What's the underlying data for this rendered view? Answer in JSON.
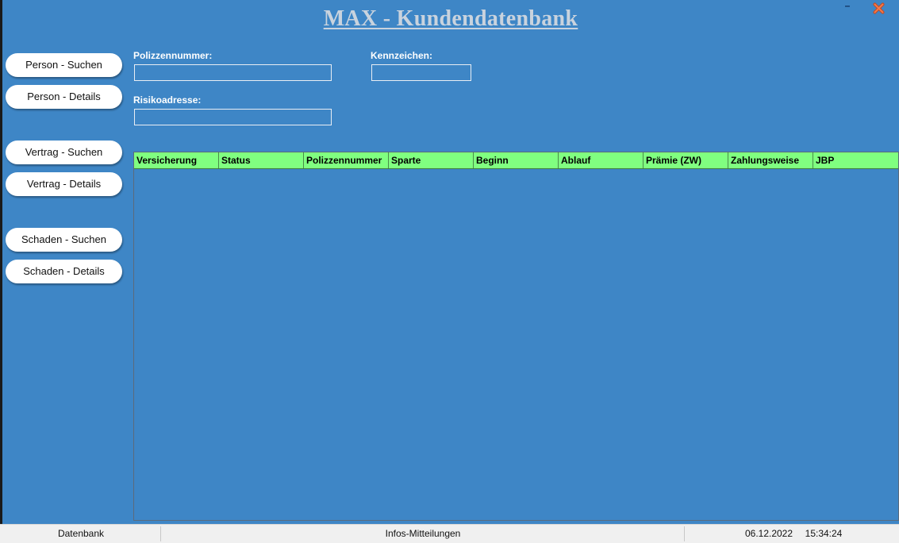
{
  "app": {
    "title": "MAX - Kundendatenbank",
    "minimize_glyph": "–"
  },
  "nav": {
    "person_search": "Person - Suchen",
    "person_details": "Person - Details",
    "contract_search": "Vertrag - Suchen",
    "contract_details": "Vertrag - Details",
    "claim_search": "Schaden - Suchen",
    "claim_details": "Schaden - Details"
  },
  "form": {
    "policy_number_label": "Polizzennummer:",
    "policy_number_value": "",
    "plate_label": "Kennzeichen:",
    "plate_value": "",
    "risk_address_label": "Risikoadresse:",
    "risk_address_value": ""
  },
  "grid": {
    "columns": [
      "Versicherung",
      "Status",
      "Polizzennummer",
      "Sparte",
      "Beginn",
      "Ablauf",
      "Prämie (ZW)",
      "Zahlungsweise",
      "JBP"
    ],
    "rows": []
  },
  "status_bar": {
    "left": "Datenbank",
    "center": "Infos-Mitteilungen",
    "date": "06.12.2022",
    "time": "15:34:24"
  },
  "colors": {
    "background": "#3e86c6",
    "grid_header": "#80ff80",
    "title": "#c9d3de",
    "close_icon": "#e0502a"
  }
}
